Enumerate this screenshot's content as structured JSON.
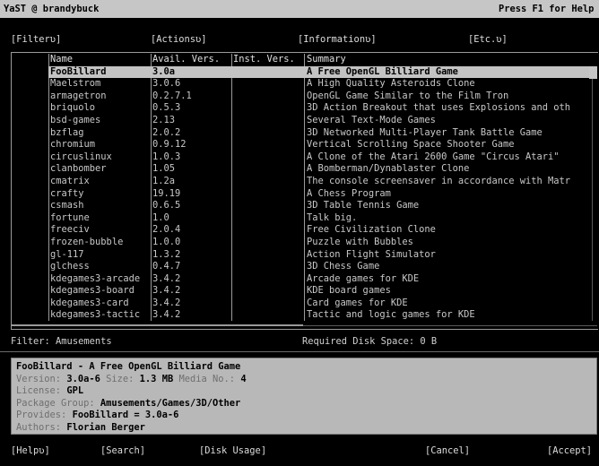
{
  "titlebar": {
    "left": "YaST @ brandybuck",
    "right": "Press F1 for Help"
  },
  "menu": [
    {
      "label": "[Filterʋ]"
    },
    {
      "label": "[Actionsʋ]"
    },
    {
      "label": "[Informationʋ]"
    },
    {
      "label": "[Etc.ʋ]"
    }
  ],
  "table": {
    "headers": {
      "name": "Name",
      "avail": "Avail. Vers.",
      "inst": "Inst. Vers.",
      "summary": "Summary"
    },
    "rows": [
      {
        "name": "FooBillard",
        "avail": "3.0a",
        "inst": "",
        "summary": "A Free OpenGL Billiard Game"
      },
      {
        "name": "Maelstrom",
        "avail": "3.0.6",
        "inst": "",
        "summary": "A High Quality Asteroids Clone"
      },
      {
        "name": "armagetron",
        "avail": "0.2.7.1",
        "inst": "",
        "summary": "OpenGL Game Similar to the Film Tron"
      },
      {
        "name": "briquolo",
        "avail": "0.5.3",
        "inst": "",
        "summary": "3D Action Breakout that uses Explosions and oth"
      },
      {
        "name": "bsd-games",
        "avail": "2.13",
        "inst": "",
        "summary": "Several Text-Mode Games"
      },
      {
        "name": "bzflag",
        "avail": "2.0.2",
        "inst": "",
        "summary": "3D Networked Multi-Player Tank Battle Game"
      },
      {
        "name": "chromium",
        "avail": "0.9.12",
        "inst": "",
        "summary": "Vertical Scrolling Space Shooter Game"
      },
      {
        "name": "circuslinux",
        "avail": "1.0.3",
        "inst": "",
        "summary": "A Clone of the Atari 2600 Game \"Circus Atari\""
      },
      {
        "name": "clanbomber",
        "avail": "1.05",
        "inst": "",
        "summary": "A Bomberman/Dynablaster Clone"
      },
      {
        "name": "cmatrix",
        "avail": "1.2a",
        "inst": "",
        "summary": "The console screensaver in accordance with Matr"
      },
      {
        "name": "crafty",
        "avail": "19.19",
        "inst": "",
        "summary": "A Chess Program"
      },
      {
        "name": "csmash",
        "avail": "0.6.5",
        "inst": "",
        "summary": "3D Table Tennis Game"
      },
      {
        "name": "fortune",
        "avail": "1.0",
        "inst": "",
        "summary": "Talk big."
      },
      {
        "name": "freeciv",
        "avail": "2.0.4",
        "inst": "",
        "summary": "Free Civilization Clone"
      },
      {
        "name": "frozen-bubble",
        "avail": "1.0.0",
        "inst": "",
        "summary": "Puzzle with Bubbles"
      },
      {
        "name": "gl-117",
        "avail": "1.3.2",
        "inst": "",
        "summary": "Action Flight Simulator"
      },
      {
        "name": "glchess",
        "avail": "0.4.7",
        "inst": "",
        "summary": "3D Chess Game"
      },
      {
        "name": "kdegames3-arcade",
        "avail": "3.4.2",
        "inst": "",
        "summary": "Arcade games for KDE"
      },
      {
        "name": "kdegames3-board",
        "avail": "3.4.2",
        "inst": "",
        "summary": "KDE board games"
      },
      {
        "name": "kdegames3-card",
        "avail": "3.4.2",
        "inst": "",
        "summary": "Card games for KDE"
      },
      {
        "name": "kdegames3-tactic",
        "avail": "3.4.2",
        "inst": "",
        "summary": "Tactic and logic games for KDE"
      }
    ]
  },
  "status": {
    "filter": "Filter: Amusements",
    "disk_space": "Required Disk Space: 0 B"
  },
  "detail": {
    "title": "FooBillard - A Free OpenGL Billiard Game",
    "version_label": "Version:",
    "version": "3.0a-6",
    "size_label": "Size:",
    "size": "1.3 MB",
    "media_label": "Media No.:",
    "media": "4",
    "license_label": "License:",
    "license": "GPL",
    "group_label": "Package Group:",
    "group": "Amusements/Games/3D/Other",
    "provides_label": "Provides:",
    "provides": "FooBillard = 3.0a-6",
    "authors_label": "Authors:",
    "authors": "Florian Berger"
  },
  "buttons": {
    "help": "[Helpʋ]",
    "search": "[Search]",
    "disk_usage": "[Disk Usage]",
    "cancel": "[Cancel]",
    "accept": "[Accept]"
  }
}
